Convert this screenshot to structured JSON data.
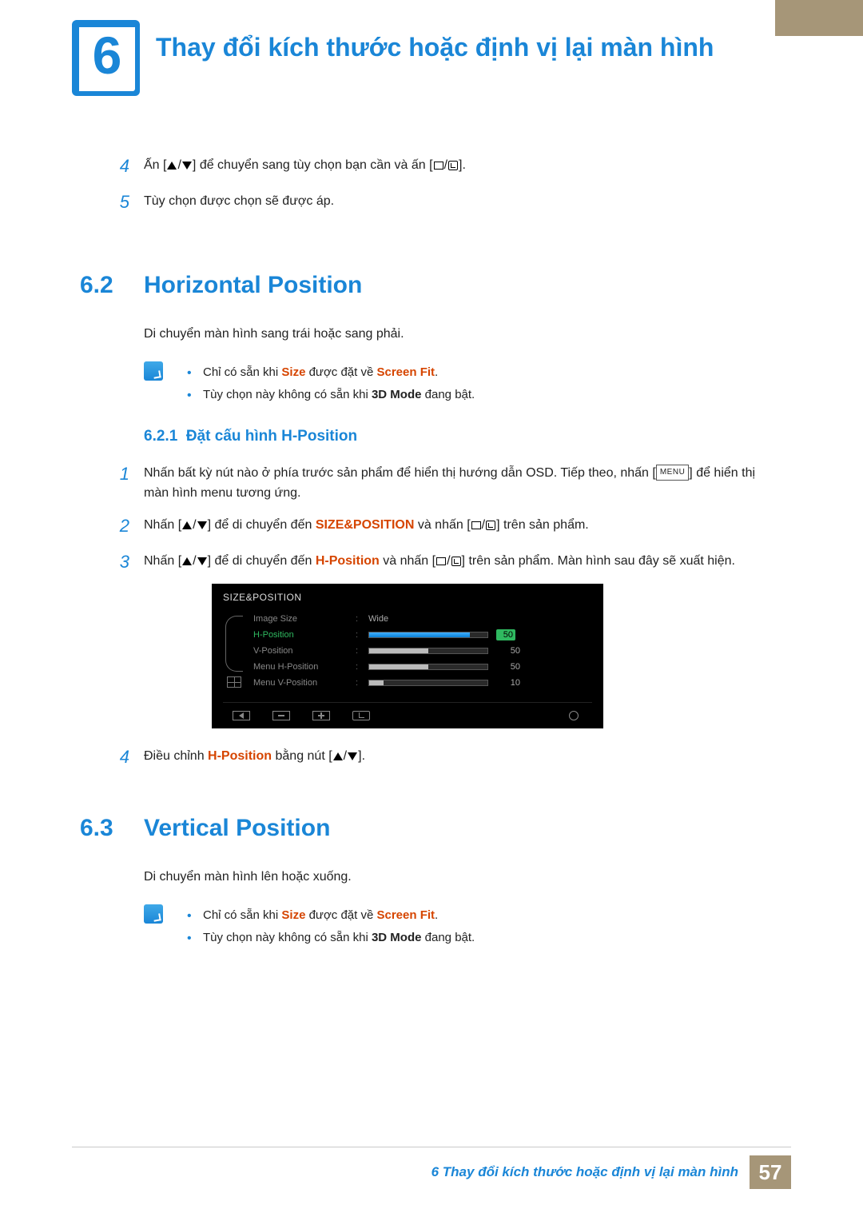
{
  "chapter": {
    "number": "6",
    "title": "Thay đổi kích thước hoặc định vị lại màn hình"
  },
  "intro_steps": {
    "s4_a": "Ấn [",
    "s4_b": "] để chuyển sang tùy chọn bạn cần và ấn [",
    "s4_c": "].",
    "s5": "Tùy chọn được chọn sẽ được áp."
  },
  "sec62": {
    "num": "6.2",
    "title": "Horizontal Position",
    "desc": "Di chuyển màn hình sang trái hoặc sang phải.",
    "note1_a": "Chỉ có sẵn khi ",
    "note1_b": "Size",
    "note1_c": " được đặt về ",
    "note1_d": "Screen Fit",
    "note1_e": ".",
    "note2_a": "Tùy chọn này không có sẵn khi ",
    "note2_b": "3D Mode",
    "note2_c": " đang bật.",
    "sub_num": "6.2.1",
    "sub_title": "Đặt cấu hình H-Position",
    "step1_a": "Nhấn bất kỳ nút nào ở phía trước sản phẩm để hiển thị hướng dẫn OSD. Tiếp theo, nhấn [",
    "step1_b": "] để hiển thị màn hình menu tương ứng.",
    "step1_menu": "MENU",
    "step2_a": "Nhấn [",
    "step2_b": "] để di chuyển đến ",
    "step2_c": "SIZE&POSITION",
    "step2_d": " và nhấn [",
    "step2_e": "] trên sản phẩm.",
    "step3_a": "Nhấn [",
    "step3_b": "] để di chuyển đến ",
    "step3_c": "H-Position",
    "step3_d": " và nhấn [",
    "step3_e": "] trên sản phẩm. Màn hình sau đây sẽ xuất hiện.",
    "step4_a": "Điều chỉnh ",
    "step4_b": "H-Position",
    "step4_c": " bằng nút [",
    "step4_d": "]."
  },
  "osd": {
    "title": "SIZE&POSITION",
    "rows": [
      {
        "label": "Image Size",
        "value": "Wide",
        "type": "text"
      },
      {
        "label": "H-Position",
        "num": "50",
        "fill": 85,
        "active": true
      },
      {
        "label": "V-Position",
        "num": "50",
        "fill": 50
      },
      {
        "label": "Menu H-Position",
        "num": "50",
        "fill": 50
      },
      {
        "label": "Menu V-Position",
        "num": "10",
        "fill": 12
      }
    ]
  },
  "sec63": {
    "num": "6.3",
    "title": "Vertical Position",
    "desc": "Di chuyển màn hình lên hoặc xuống.",
    "note1_a": "Chỉ có sẵn khi ",
    "note1_b": "Size",
    "note1_c": " được đặt về ",
    "note1_d": "Screen Fit",
    "note1_e": ".",
    "note2_a": "Tùy chọn này không có sẵn khi ",
    "note2_b": "3D Mode",
    "note2_c": " đang bật."
  },
  "footer": {
    "text": "6 Thay đổi kích thước hoặc định vị lại màn hình",
    "page": "57"
  }
}
